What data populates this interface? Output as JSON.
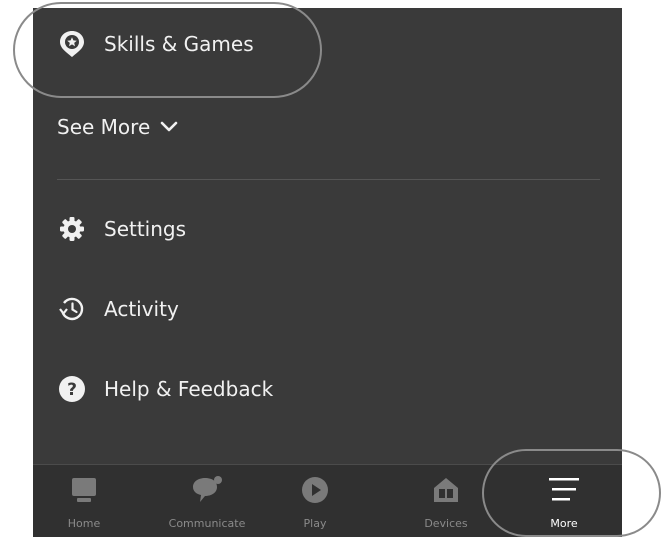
{
  "menu": {
    "skills_label": "Skills & Games",
    "see_more_label": "See More",
    "settings_label": "Settings",
    "activity_label": "Activity",
    "help_label": "Help & Feedback"
  },
  "bottom_nav": {
    "home": "Home",
    "communicate": "Communicate",
    "play": "Play",
    "devices": "Devices",
    "more": "More"
  },
  "colors": {
    "background": "#3a3a3a",
    "nav_background": "#303030",
    "text": "#f1f1f1",
    "inactive_nav": "#8a8a8a",
    "active_nav": "#ffffff"
  }
}
